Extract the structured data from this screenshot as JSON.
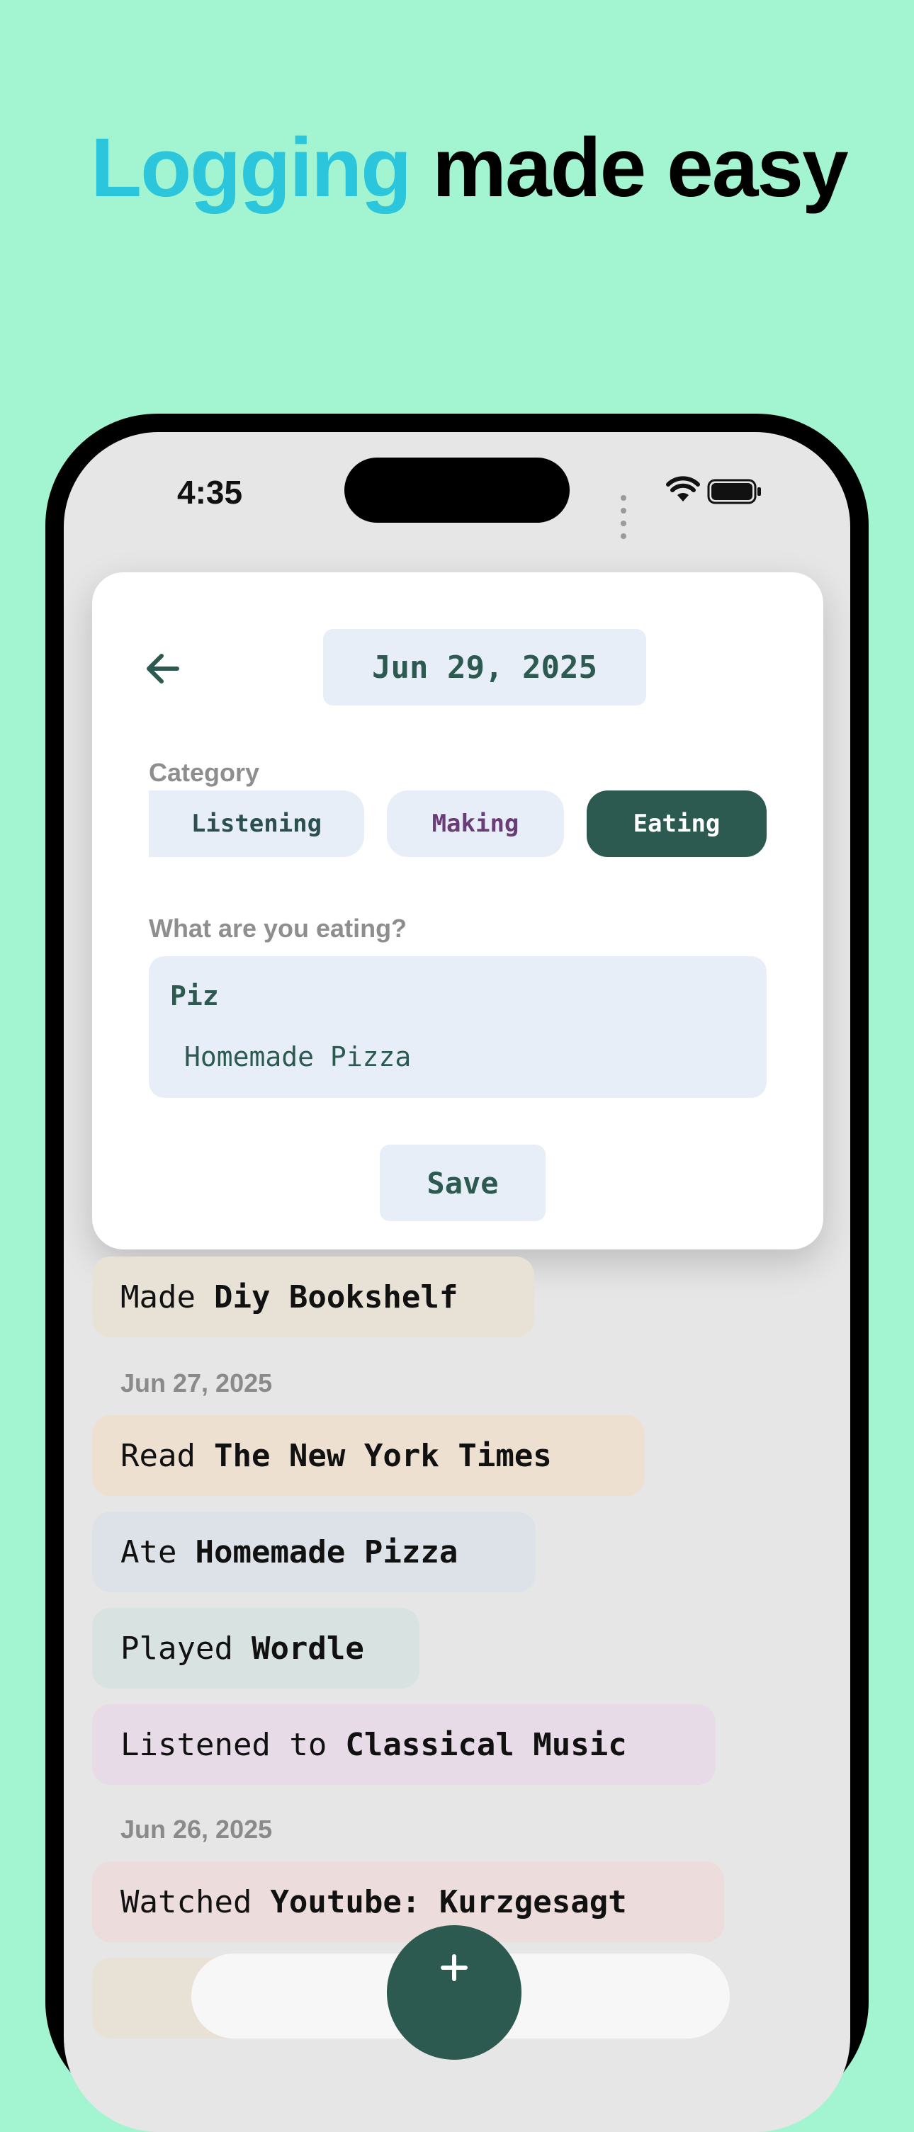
{
  "headline": {
    "accent": "Logging",
    "rest": " made easy"
  },
  "status_bar": {
    "time": "4:35"
  },
  "editor": {
    "date": "Jun 29, 2025",
    "category_label": "Category",
    "categories": [
      {
        "label": "Listening",
        "selected": false
      },
      {
        "label": "Making",
        "selected": false
      },
      {
        "label": "Eating",
        "selected": true
      }
    ],
    "prompt": "What are you eating?",
    "input_value": "Piz",
    "suggestion": "Homemade Pizza",
    "save_label": "Save"
  },
  "log": {
    "entries_top": [
      {
        "verb": "Made",
        "object": "Diy Bookshelf"
      }
    ],
    "days": [
      {
        "date": "Jun 27, 2025",
        "entries": [
          {
            "verb": "Read",
            "object": "The New York Times"
          },
          {
            "verb": "Ate",
            "object": "Homemade Pizza"
          },
          {
            "verb": "Played",
            "object": "Wordle"
          },
          {
            "verb": "Listened to",
            "object": "Classical Music"
          }
        ]
      },
      {
        "date": "Jun 26, 2025",
        "entries": [
          {
            "verb": "Watched",
            "object": "Youtube: Kurzgesagt"
          }
        ]
      }
    ]
  },
  "colors": {
    "background": "#a3f5d1",
    "accent": "#2bc5dc",
    "primary_green": "#2d5a50",
    "chip_bg": "#e8eef8",
    "making_text": "#6a3c78",
    "entry_made": "#e8e2d6",
    "entry_read": "#ede0d0",
    "entry_ate": "#dde2e9",
    "entry_played": "#d8e2e0",
    "entry_listened": "#e6dbe6",
    "entry_watched": "#ecdcdc"
  },
  "icons": {
    "back": "arrow-left-icon",
    "wifi": "wifi-icon",
    "battery": "battery-icon",
    "add": "plus-icon"
  }
}
